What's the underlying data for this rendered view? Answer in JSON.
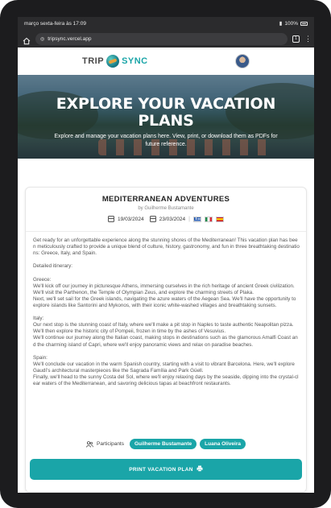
{
  "status_bar": {
    "datetime": "março sexta-feira às 17:09",
    "battery": "100%"
  },
  "browser": {
    "url": "tripsync.vercel.app",
    "tab_count": "1"
  },
  "header": {
    "logo_trip": "TRIP",
    "logo_sync": "SYNC"
  },
  "hero": {
    "title": "EXPLORE YOUR VACATION PLANS",
    "subtitle": "Explore and manage your vacation plans here. View, print, or download them as PDFs for future reference."
  },
  "plan": {
    "title": "MEDITERRANEAN ADVENTURES",
    "author": "by Guilherme Bustamante",
    "start_date": "19/03/2024",
    "end_date": "23/03/2024",
    "countries": [
      "Greece",
      "Italy",
      "Spain"
    ],
    "description": "Get ready for an unforgettable experience along the stunning shores of the Mediterranean! This vacation plan has been meticulously crafted to provide a unique blend of culture, history, gastronomy, and fun in three breathtaking destinations: Greece, Italy, and Spain.\n\nDetailed itinerary:\n\nGreece:\nWe'll kick off our journey in picturesque Athens, immersing ourselves in the rich heritage of ancient Greek civilization. We'll visit the Parthenon, the Temple of Olympian Zeus, and explore the charming streets of Plaka.\nNext, we'll set sail for the Greek islands, navigating the azure waters of the Aegean Sea. We'll have the opportunity to explore islands like Santorini and Mykonos, with their iconic white-washed villages and breathtaking sunsets.\n\nItaly:\nOur next stop is the stunning coast of Italy, where we'll make a pit stop in Naples to taste authentic Neapolitan pizza. We'll then explore the historic city of Pompeii, frozen in time by the ashes of Vesuvius.\nWe'll continue our journey along the Italian coast, making stops in destinations such as the glamorous Amalfi Coast and the charming island of Capri, where we'll enjoy panoramic views and relax on paradise beaches.\n\nSpain:\nWe'll conclude our vacation in the warm Spanish country, starting with a visit to vibrant Barcelona. Here, we'll explore Gaudí's architectural masterpieces like the Sagrada Família and Park Güell.\nFinally, we'll head to the sunny Costa del Sol, where we'll enjoy relaxing days by the seaside, dipping into the crystal-clear waters of the Mediterranean, and savoring delicious tapas at beachfront restaurants.",
    "participants_label": "Participants",
    "participants": [
      "Guilherme Bustamante",
      "Luana Oliveira"
    ],
    "print_button": "PRINT VACATION PLAN"
  },
  "colors": {
    "accent": "#1aa5a8"
  },
  "icons": [
    "home-icon",
    "url-lock-icon",
    "tabs-icon",
    "menu-icon",
    "calendar-icon",
    "people-icon",
    "printer-icon"
  ]
}
